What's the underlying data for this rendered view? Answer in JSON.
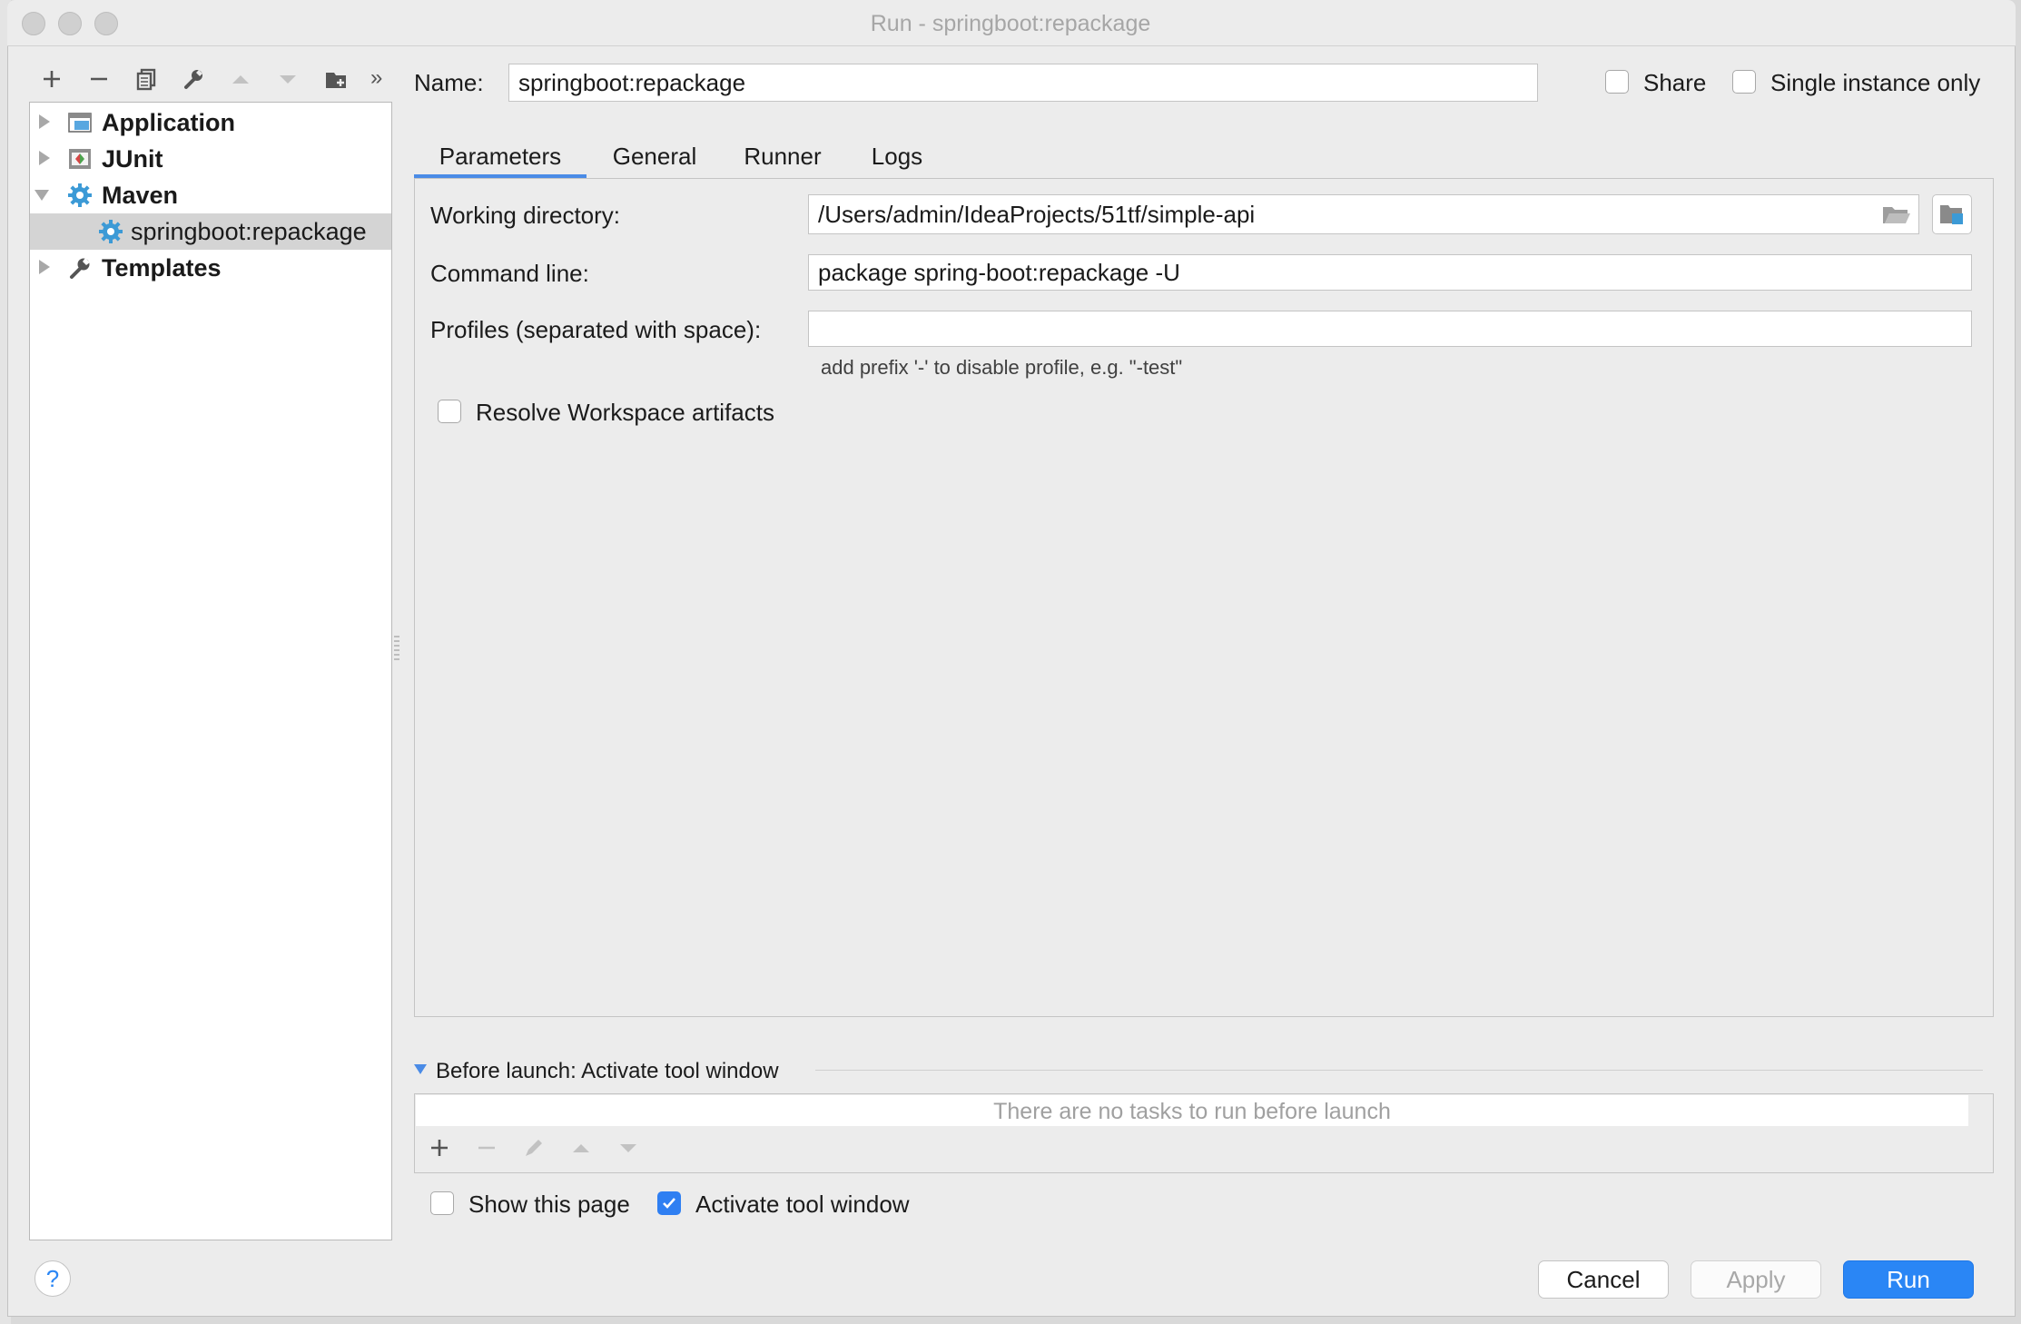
{
  "window": {
    "title": "Run - springboot:repackage"
  },
  "toolbar": {
    "icons": [
      "add-icon",
      "remove-icon",
      "copy-icon",
      "wrench-icon",
      "move-up-icon",
      "move-down-icon",
      "folder-add-icon",
      "more-icon"
    ],
    "more_label": "»"
  },
  "tree": {
    "items": [
      {
        "label": "Application",
        "icon": "application-icon",
        "bold": true,
        "expanded": false
      },
      {
        "label": "JUnit",
        "icon": "junit-icon",
        "bold": true,
        "expanded": false
      },
      {
        "label": "Maven",
        "icon": "maven-gear-icon",
        "bold": true,
        "expanded": true
      },
      {
        "label": "springboot:repackage",
        "icon": "maven-gear-icon",
        "bold": false,
        "selected": true
      },
      {
        "label": "Templates",
        "icon": "wrench-icon",
        "bold": true,
        "expanded": false
      }
    ]
  },
  "name": {
    "label": "Name:",
    "value": "springboot:repackage"
  },
  "share": {
    "label": "Share",
    "checked": false
  },
  "single_instance": {
    "label": "Single instance only",
    "checked": false
  },
  "tabs": [
    {
      "label": "Parameters",
      "active": true
    },
    {
      "label": "General"
    },
    {
      "label": "Runner"
    },
    {
      "label": "Logs"
    }
  ],
  "parameters": {
    "working_directory": {
      "label": "Working directory:",
      "value": "/Users/admin/IdeaProjects/51tf/simple-api"
    },
    "command_line": {
      "label": "Command line:",
      "value": "package spring-boot:repackage -U"
    },
    "profiles": {
      "label": "Profiles (separated with space):",
      "value": "",
      "hint": "add prefix '-' to disable profile, e.g. \"-test\""
    },
    "resolve_workspace": {
      "label": "Resolve Workspace artifacts",
      "checked": false
    }
  },
  "before_launch": {
    "title": "Before launch: Activate tool window",
    "empty_text": "There are no tasks to run before launch",
    "icons": [
      "add-icon",
      "remove-icon",
      "edit-icon",
      "move-up-icon",
      "move-down-icon"
    ]
  },
  "show_page": {
    "label": "Show this page",
    "checked": false
  },
  "activate_tool_window": {
    "label": "Activate tool window",
    "checked": true
  },
  "buttons": {
    "help": "?",
    "cancel": "Cancel",
    "apply": "Apply",
    "run": "Run"
  },
  "colors": {
    "accent": "#2a86f5",
    "maven_blue": "#3c9ad6",
    "selection": "#d4d4d4"
  }
}
